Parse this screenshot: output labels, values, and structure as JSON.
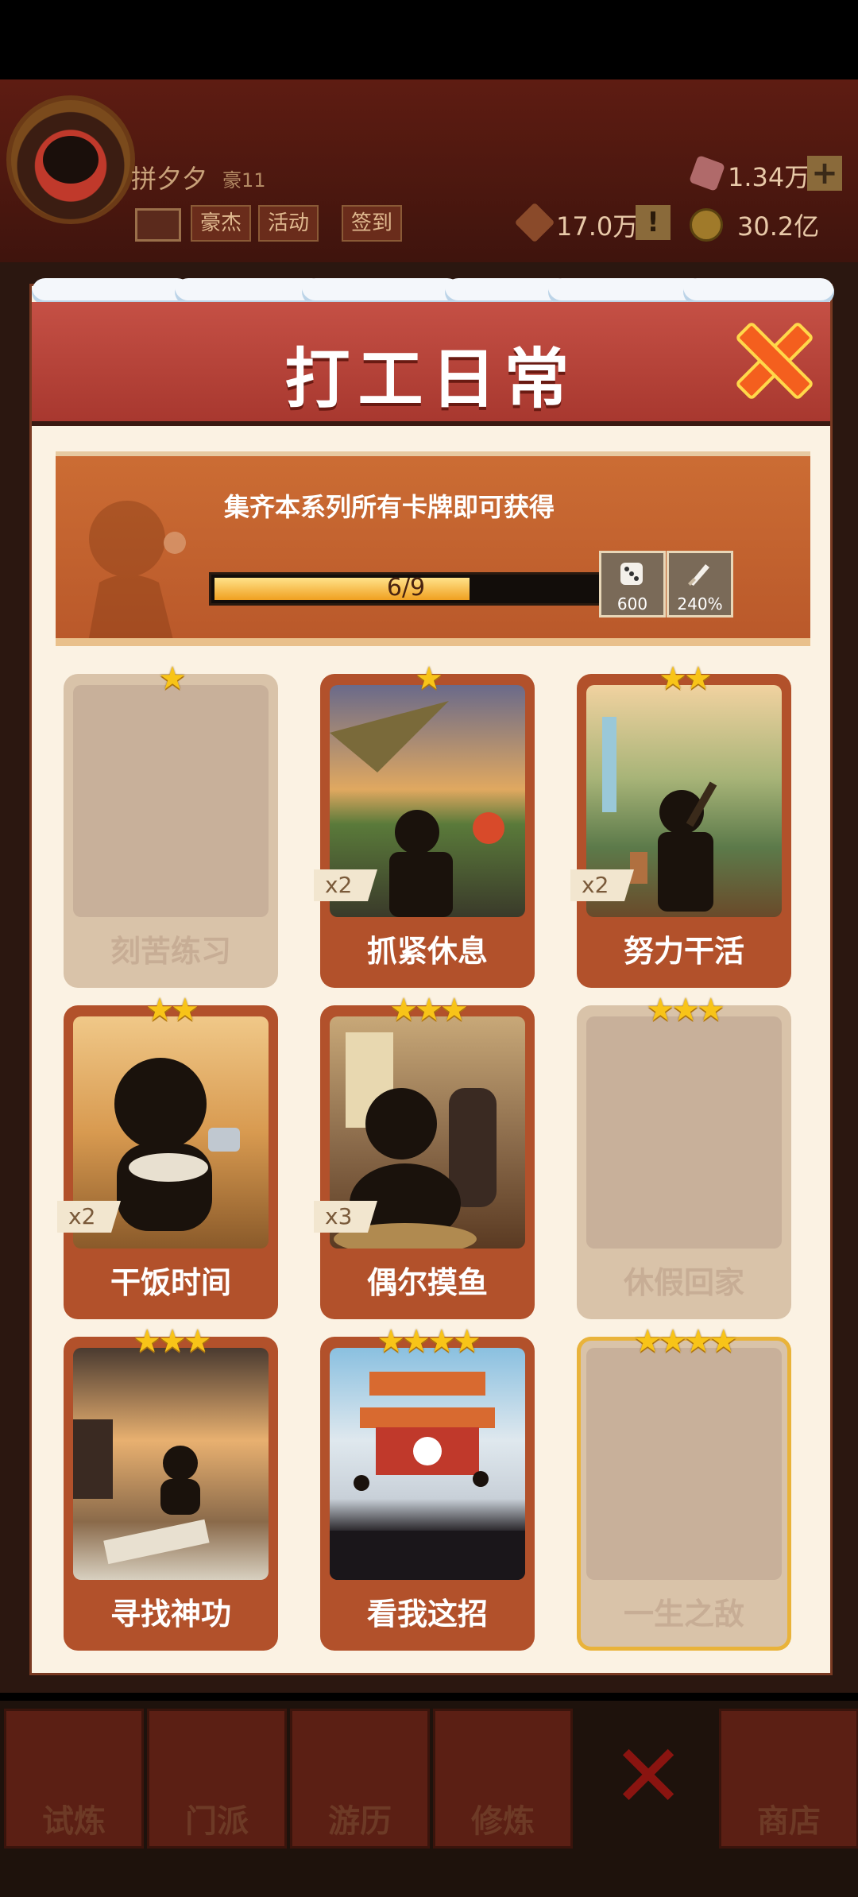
{
  "hud": {
    "player_name": "拼夕夕",
    "rank": "豪11",
    "chips": [
      "豪杰",
      "活动",
      "签到"
    ],
    "gems": "1.34万",
    "power": "17.0万",
    "coins": "30.2亿",
    "plus": "+",
    "warn": "!"
  },
  "dialog": {
    "title": "打工日常",
    "hint": "集齐本系列所有卡牌即可获得",
    "progress_text": "6/9",
    "progress_fraction": 0.667,
    "rewards": [
      {
        "icon": "dice-icon",
        "value": "600"
      },
      {
        "icon": "sword-icon",
        "value": "240%"
      }
    ]
  },
  "cards": [
    {
      "name": "刻苦练习",
      "stars": "★",
      "state": "empty",
      "mult": ""
    },
    {
      "name": "抓紧休息",
      "stars": "★",
      "state": "owned",
      "mult": "x2"
    },
    {
      "name": "努力干活",
      "stars": "★★",
      "state": "owned",
      "mult": "x2"
    },
    {
      "name": "干饭时间",
      "stars": "★★",
      "state": "owned",
      "mult": "x2"
    },
    {
      "name": "偶尔摸鱼",
      "stars": "★★★",
      "state": "owned",
      "mult": "x3"
    },
    {
      "name": "休假回家",
      "stars": "★★★",
      "state": "empty",
      "mult": ""
    },
    {
      "name": "寻找神功",
      "stars": "★★★",
      "state": "owned",
      "mult": ""
    },
    {
      "name": "看我这招",
      "stars": "★★★★",
      "state": "owned",
      "mult": ""
    },
    {
      "name": "一生之敌",
      "stars": "★★★★",
      "state": "legend",
      "mult": ""
    }
  ],
  "bottom_nav": [
    "试炼",
    "门派",
    "游历",
    "修炼",
    "商店"
  ],
  "colors": {
    "accent": "#f45f1e",
    "header": "#b8443a",
    "card_owned": "#b2512b",
    "card_empty": "#d9c3a9",
    "star": "#f8c418"
  }
}
